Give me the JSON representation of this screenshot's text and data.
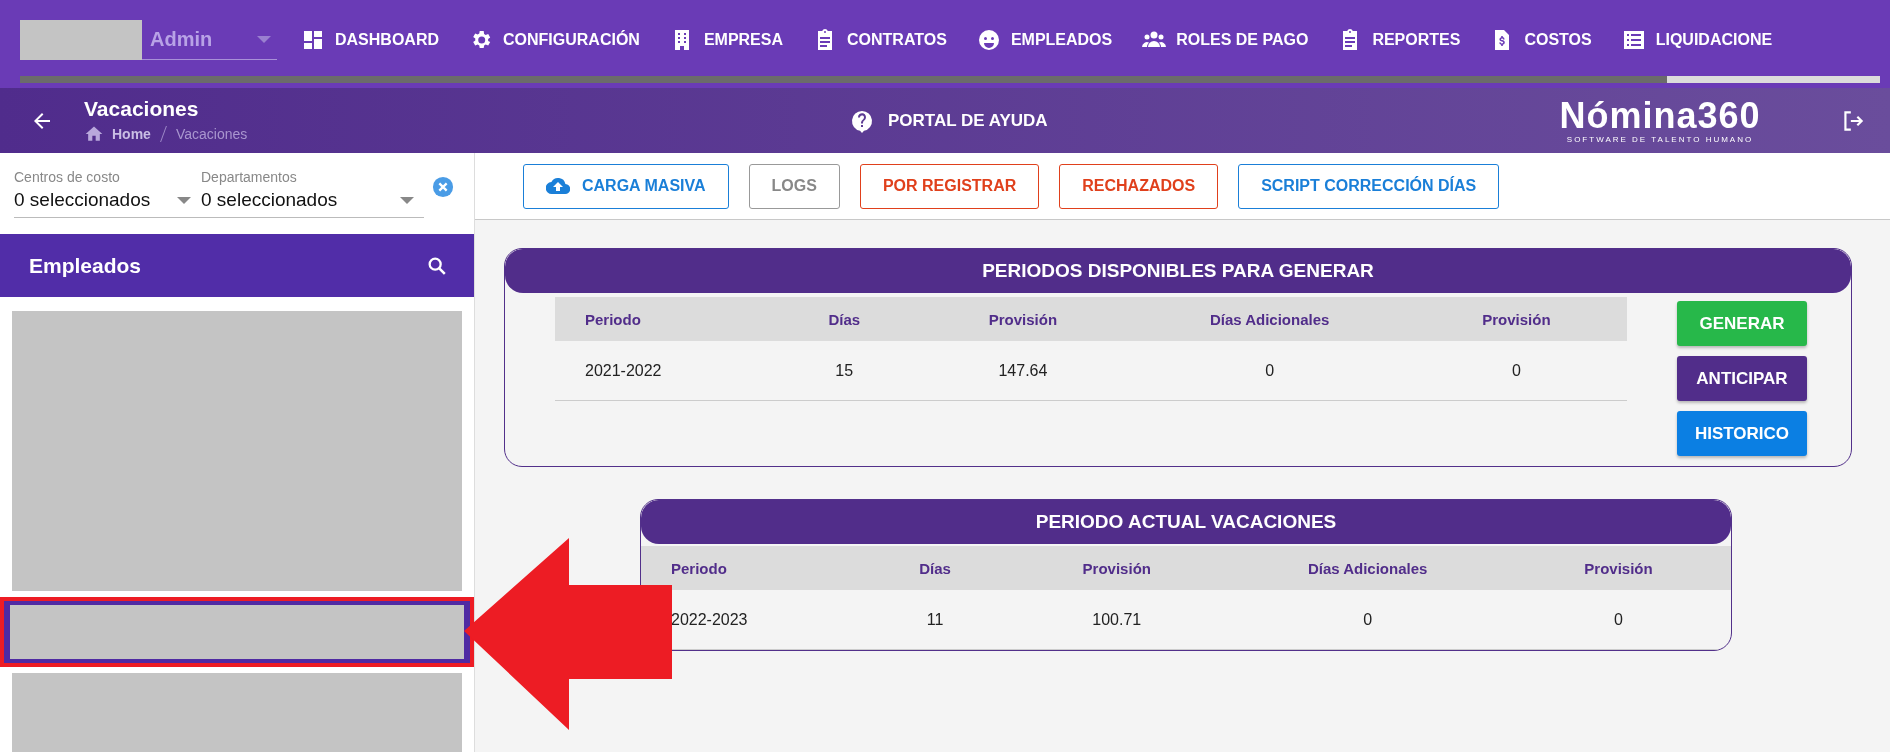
{
  "top_nav": {
    "user_select": {
      "value": "Admin"
    },
    "items": [
      {
        "label": "DASHBOARD",
        "kind": "dashboard"
      },
      {
        "label": "CONFIGURACIÓN",
        "kind": "gear"
      },
      {
        "label": "EMPRESA",
        "kind": "building"
      },
      {
        "label": "CONTRATOS",
        "kind": "clipboard"
      },
      {
        "label": "EMPLEADOS",
        "kind": "face"
      },
      {
        "label": "ROLES DE PAGO",
        "kind": "people"
      },
      {
        "label": "REPORTES",
        "kind": "clipboard"
      },
      {
        "label": "COSTOS",
        "kind": "invoice"
      },
      {
        "label": "LIQUIDACIONE",
        "kind": "list"
      }
    ]
  },
  "header": {
    "title": "Vacaciones",
    "breadcrumb": [
      "Home",
      "Vacaciones"
    ],
    "help_link": "PORTAL DE AYUDA",
    "logo": "Nómina360",
    "tagline": "SOFTWARE DE TALENTO HUMANO"
  },
  "filters": [
    {
      "label": "Centros de costo",
      "value": "0 seleccionados"
    },
    {
      "label": "Departamentos",
      "value": "0 seleccionados"
    }
  ],
  "employees_panel": {
    "title": "Empleados",
    "rows": [
      {
        "kind": "tall",
        "selected": false
      },
      {
        "kind": "short",
        "selected": true
      },
      {
        "kind": "tall",
        "selected": false
      }
    ]
  },
  "toolbar": [
    {
      "label": "CARGA MASIVA",
      "kind": "upload"
    },
    {
      "label": "LOGS",
      "kind": "neutral"
    },
    {
      "label": "POR REGISTRAR",
      "kind": "danger"
    },
    {
      "label": "RECHAZADOS",
      "kind": "danger"
    },
    {
      "label": "SCRIPT CORRECCIÓN DÍAS",
      "kind": "primary"
    }
  ],
  "cards": [
    {
      "title": "PERIODOS DISPONIBLES PARA GENERAR",
      "columns": [
        "Periodo",
        "Días",
        "Provisión",
        "Días Adicionales",
        "Provisión"
      ],
      "rows": [
        [
          "2021-2022",
          "15",
          "147.64",
          "0",
          "0"
        ]
      ],
      "actions": [
        {
          "label": "GENERAR",
          "kind": "success"
        },
        {
          "label": "ANTICIPAR",
          "kind": "purple"
        },
        {
          "label": "HISTORICO",
          "kind": "info"
        }
      ]
    },
    {
      "title": "PERIODO ACTUAL VACACIONES",
      "columns": [
        "Periodo",
        "Días",
        "Provisión",
        "Días Adicionales",
        "Provisión"
      ],
      "rows": [
        [
          "2022-2023",
          "11",
          "100.71",
          "0",
          "0"
        ]
      ]
    }
  ]
}
